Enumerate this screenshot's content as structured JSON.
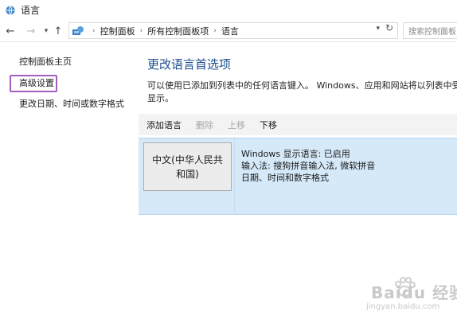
{
  "window": {
    "title": "语言"
  },
  "nav": {
    "back_icon": "back-arrow-icon",
    "forward_icon": "forward-arrow-icon",
    "recent_icon": "chevron-down-icon",
    "up_icon": "up-arrow-icon"
  },
  "address": {
    "crumbs": [
      "控制面板",
      "所有控制面板项",
      "语言"
    ],
    "refresh_icon": "refresh-icon"
  },
  "search": {
    "placeholder": "搜索控制面板"
  },
  "sidebar": {
    "home": "控制面板主页",
    "advanced": "高级设置",
    "date_time": "更改日期、时间或数字格式"
  },
  "main": {
    "title": "更改语言首选项",
    "desc_line1": "可以使用已添加到列表中的任何语言键入。 Windows、应用和网站将以列表中受支持",
    "desc_line2": "显示。"
  },
  "toolbar": {
    "add": "添加语言",
    "remove": "删除",
    "up": "上移",
    "down": "下移"
  },
  "language": {
    "name_line1": "中文(中华人民共",
    "name_line2": "和国)",
    "display": "Windows 显示语言: 已启用",
    "ime": "输入法: 搜狗拼音输入法, 微软拼音",
    "formats": "日期、时间和数字格式"
  },
  "watermark": {
    "main": "Baidu 经验",
    "sub": "jingyan.baidu.com"
  },
  "colors": {
    "title_blue": "#1c4d8c",
    "row_selected": "#d5e9f8",
    "highlight_border": "#a35fc0"
  }
}
